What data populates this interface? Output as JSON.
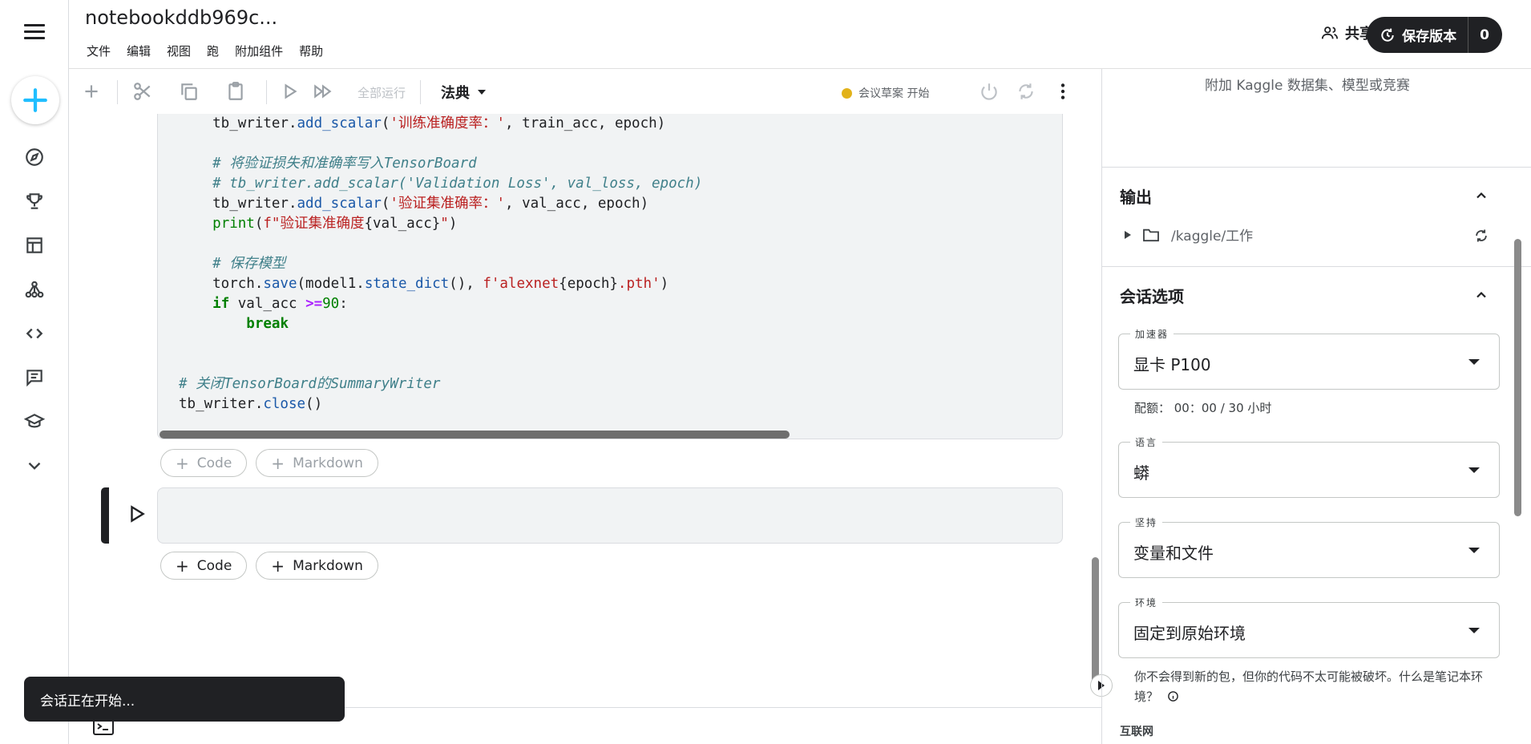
{
  "header": {
    "title": "notebookddb969c...",
    "menu": [
      "文件",
      "编辑",
      "视图",
      "跑",
      "附加组件",
      "帮助"
    ],
    "share_label": "共享",
    "save_label": "保存版本",
    "save_count": "0"
  },
  "toolbar": {
    "run_all_label": "全部运行",
    "mode_label": "法典",
    "session_status": "会议草案 开始"
  },
  "code": {
    "lines": [
      "    tb_writer.add_scalar('训练准确度率：', train_acc, epoch)",
      "",
      "    # 将验证损失和准确率写入TensorBoard",
      "    # tb_writer.add_scalar('Validation Loss', val_loss, epoch)",
      "    tb_writer.add_scalar('验证集准确率：', val_acc, epoch)",
      "    print(f\"验证集准确度{val_acc}\")",
      "",
      "    # 保存模型",
      "    torch.save(model1.state_dict(), f'alexnet{epoch}.pth')",
      "    if val_acc >=90:",
      "        break",
      "",
      "",
      "# 关闭TensorBoard的SummaryWriter",
      "tb_writer.close()"
    ]
  },
  "add_cell": {
    "code_label": "Code",
    "markdown_label": "Markdown"
  },
  "toast": "会话正在开始...",
  "panel": {
    "attach_text": "附加 Kaggle 数据集、模型或竞赛",
    "output_title": "输出",
    "output_path": "/kaggle/工作",
    "session_title": "会话选项",
    "accelerator_label": "加速器",
    "accelerator_value": "显卡 P100",
    "quota_text": "配额：   00：00 / 30 小时",
    "language_label": "语言",
    "language_value": "蟒",
    "persistence_label": "坚持",
    "persistence_value": "变量和文件",
    "environment_label": "环境",
    "environment_value": "固定到原始环境",
    "environment_note": "你不会得到新的包，但你的代码不太可能被破坏。什么是笔记本环境？",
    "internet_label": "互联网"
  },
  "colors": {
    "accent": "#20beff",
    "dark": "#202124",
    "status_dot": "#e2b21a"
  }
}
